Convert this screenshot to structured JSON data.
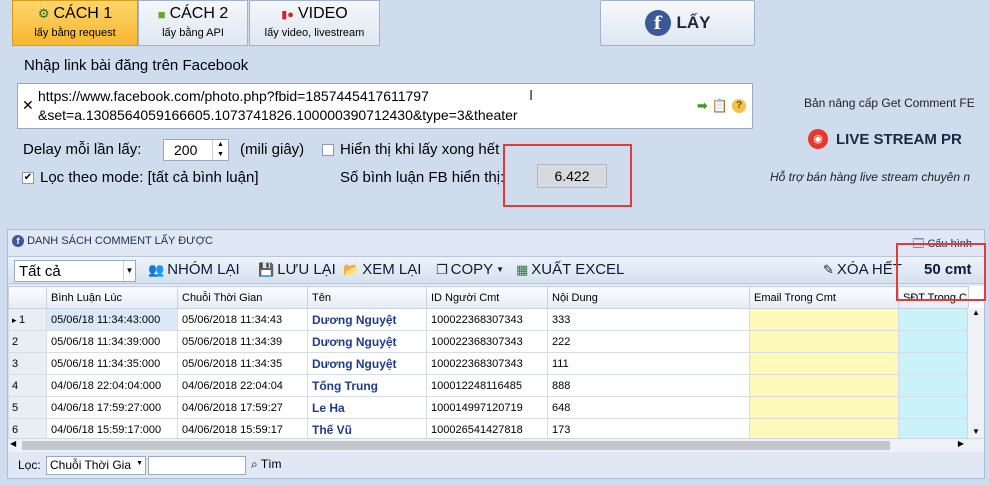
{
  "tabs": [
    {
      "label": "CÁCH 1",
      "sub": "lấy bằng request",
      "icon": "gear-icon"
    },
    {
      "label": "CÁCH 2",
      "sub": "lấy bằng API",
      "icon": "cube-icon"
    },
    {
      "label": "VIDEO",
      "sub": "lấy video, livestream",
      "icon": "record-icon"
    }
  ],
  "get_button": {
    "label": "LẤY",
    "icon": "facebook-icon"
  },
  "link": {
    "label": "Nhập link bài đăng trên Facebook",
    "value": "https://www.facebook.com/photo.php?fbid=1857445417611797\n&set=a.1308564059166605.1073741826.100000390712430&type=3&theater"
  },
  "delay": {
    "label": "Delay mỗi lần lấy:",
    "value": "200",
    "unit": "(mili giây)"
  },
  "show_after": {
    "label": "Hiển thị khi lấy xong hết",
    "checked": false
  },
  "filter_mode": {
    "label": "Lọc theo mode: [tất cả bình luận]",
    "checked": true
  },
  "fb_count": {
    "label": "Số bình luận FB hiển thị:",
    "value": "6.422"
  },
  "promo": {
    "upgrade": "Bản nâng cấp Get Comment FE",
    "live": "LIVE STREAM PR",
    "support": "Hỗ trợ bán hàng live stream chuyên n"
  },
  "panel": {
    "title": "DANH SÁCH COMMENT LẤY ĐƯỢC",
    "config": "Cấu hình"
  },
  "toolbar": {
    "filter_value": "Tất cả",
    "group": "NHÓM LẠI",
    "save": "LƯU LẠI",
    "view": "XEM LẠI",
    "copy": "COPY",
    "export": "XUẤT EXCEL",
    "clear": "XÓA HẾT",
    "count": "50 cmt"
  },
  "table": {
    "headers": [
      "Bình Luận Lúc",
      "Chuỗi Thời Gian",
      "Tên",
      "ID Người Cmt",
      "Nội Dung",
      "Email Trong Cmt",
      "SĐT Trong C"
    ],
    "rows": [
      {
        "n": "1",
        "time": "05/06/18 11:34:43:000",
        "chain": "05/06/2018 11:34:43",
        "name": "Dương Nguyệt",
        "id": "100022368307343",
        "content": "333"
      },
      {
        "n": "2",
        "time": "05/06/18 11:34:39:000",
        "chain": "05/06/2018 11:34:39",
        "name": "Dương Nguyệt",
        "id": "100022368307343",
        "content": "222"
      },
      {
        "n": "3",
        "time": "05/06/18 11:34:35:000",
        "chain": "05/06/2018 11:34:35",
        "name": "Dương Nguyệt",
        "id": "100022368307343",
        "content": "111"
      },
      {
        "n": "4",
        "time": "04/06/18 22:04:04:000",
        "chain": "04/06/2018 22:04:04",
        "name": "Tống Trung",
        "id": "100012248116485",
        "content": "888"
      },
      {
        "n": "5",
        "time": "04/06/18 17:59:27:000",
        "chain": "04/06/2018 17:59:27",
        "name": "Le Ha",
        "id": "100014997120719",
        "content": "648"
      },
      {
        "n": "6",
        "time": "04/06/18 15:59:17:000",
        "chain": "04/06/2018 15:59:17",
        "name": "Thế Vũ",
        "id": "100026541427818",
        "content": "173"
      }
    ]
  },
  "filterbar": {
    "label": "Lọc:",
    "field": "Chuỗi Thời Gia",
    "search": "Tìm"
  }
}
